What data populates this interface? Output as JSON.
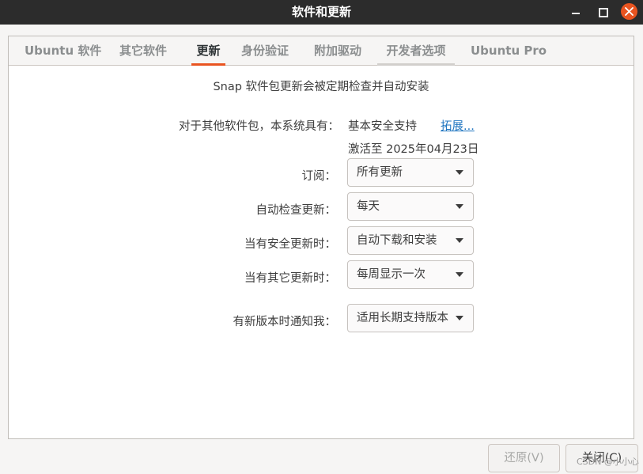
{
  "window": {
    "title": "软件和更新"
  },
  "tabs": [
    {
      "label": "Ubuntu 软件"
    },
    {
      "label": "其它软件"
    },
    {
      "label": "更新"
    },
    {
      "label": "身份验证"
    },
    {
      "label": "附加驱动"
    },
    {
      "label": "开发者选项"
    },
    {
      "label": "Ubuntu Pro"
    }
  ],
  "updates": {
    "snap_notice": "Snap 软件包更新会被定期检查并自动安装",
    "support_label": "对于其他软件包，本系统具有：",
    "support_value": "基本安全支持",
    "expand_link": "拓展...",
    "activated_until": "激活至 2025年04月23日",
    "subscribed": {
      "label": "订阅：",
      "value": "所有更新"
    },
    "auto_check": {
      "label": "自动检查更新：",
      "value": "每天"
    },
    "security_updates": {
      "label": "当有安全更新时：",
      "value": "自动下载和安装"
    },
    "other_updates": {
      "label": "当有其它更新时：",
      "value": "每周显示一次"
    },
    "notify_version": {
      "label": "有新版本时通知我：",
      "value": "适用长期支持版本"
    }
  },
  "footer": {
    "revert_label": "还原(V)",
    "close_label": "关闭(C)",
    "watermark": "CSDN @小小心"
  }
}
